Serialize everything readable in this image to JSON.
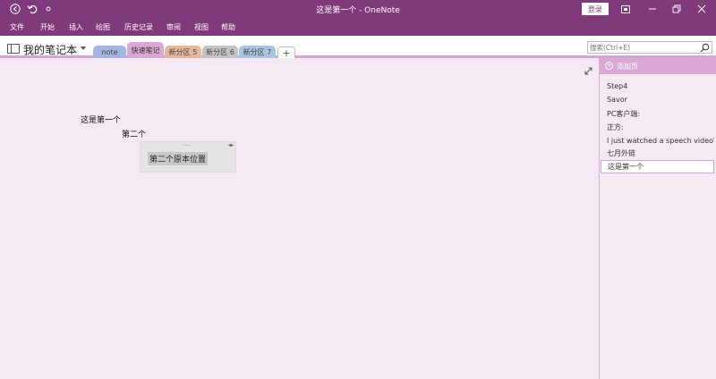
{
  "titlebar": {
    "title": "这是第一个  -  OneNote",
    "signin_label": "登录",
    "back_icon": "back-arrow-icon",
    "undo_icon": "undo-icon",
    "touch_icon": "touch-mode-icon"
  },
  "menu": {
    "items": [
      "文件",
      "开始",
      "插入",
      "绘图",
      "历史记录",
      "审阅",
      "视图",
      "帮助"
    ]
  },
  "notebook": {
    "title": "我的笔记本",
    "sections": [
      {
        "label": "note",
        "color": "#a3b5e0"
      },
      {
        "label": "快速笔记",
        "color": "#dba8d6"
      },
      {
        "label": "新分区 5",
        "color": "#e5b79b"
      },
      {
        "label": "新分区 6",
        "color": "#c4c4c4"
      },
      {
        "label": "新分区 7",
        "color": "#a8c4e0"
      }
    ],
    "add_section_label": "+",
    "search_placeholder": "搜索(Ctrl+E)"
  },
  "page": {
    "line1": "这是第一个",
    "line2": "第二个",
    "container_text": "第二个原本位置"
  },
  "pagelist": {
    "add_page_label": "添加页",
    "pages": [
      "Step4",
      "Savor",
      "PC客户端:",
      "正方:",
      "I just watched a speech videoTh",
      "七月外链",
      "这是第一个"
    ],
    "selected_index": 6
  },
  "colors": {
    "brand": "#80397b",
    "accent": "#dba8d6",
    "canvas": "#f5e9f4"
  }
}
